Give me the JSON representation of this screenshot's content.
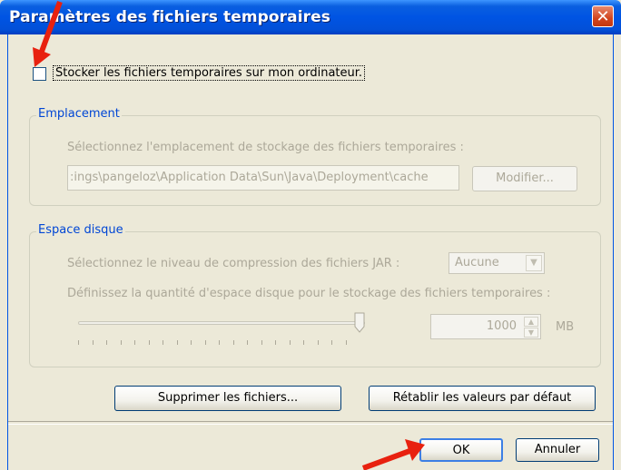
{
  "window": {
    "title": "Paramètres des fichiers temporaires",
    "close_glyph": "✕"
  },
  "store_checkbox": {
    "label": "Stocker les fichiers temporaires sur mon ordinateur.",
    "checked": false
  },
  "location": {
    "group_title": "Emplacement",
    "prompt": "Sélectionnez l'emplacement de stockage des fichiers temporaires :",
    "path_value": ":ings\\pangeloz\\Application Data\\Sun\\Java\\Deployment\\cache",
    "modify_label": "Modifier..."
  },
  "disk": {
    "group_title": "Espace disque",
    "compression_prompt": "Sélectionnez le niveau de compression des fichiers JAR :",
    "compression_value": "Aucune",
    "space_prompt": "Définissez la quantité d'espace disque pour le stockage des fichiers temporaires :",
    "space_value": "1000",
    "space_unit": "MB",
    "slider_level": 1.0
  },
  "buttons": {
    "delete_files": "Supprimer les fichiers...",
    "restore_defaults": "Rétablir les valeurs par défaut",
    "ok": "OK",
    "cancel": "Annuler"
  },
  "colors": {
    "title_bar": "#0054e3",
    "group_title": "#0046d5",
    "annotation_arrow": "#e8210f"
  }
}
